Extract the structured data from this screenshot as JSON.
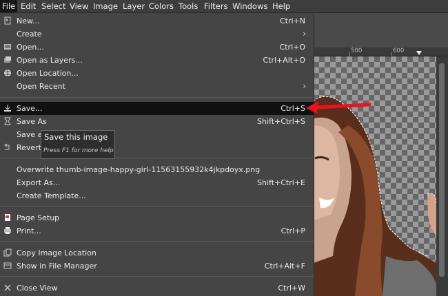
{
  "menubar": {
    "items": [
      "File",
      "Edit",
      "Select",
      "View",
      "Image",
      "Layer",
      "Colors",
      "Tools",
      "Filters",
      "Windows",
      "Help"
    ]
  },
  "ruler": {
    "ticks": [
      "500",
      "600"
    ]
  },
  "file_menu": {
    "new": {
      "label": "New...",
      "shortcut": "Ctrl+N",
      "icon": "new-image-icon"
    },
    "create": {
      "label": "Create",
      "submenu": "›"
    },
    "open": {
      "label": "Open...",
      "shortcut": "Ctrl+O",
      "icon": "open-image-icon"
    },
    "open_layers": {
      "label": "Open as Layers...",
      "shortcut": "Ctrl+Alt+O",
      "icon": "open-layers-icon"
    },
    "open_location": {
      "label": "Open Location...",
      "icon": "globe-icon"
    },
    "open_recent": {
      "label": "Open Recent",
      "submenu": "›"
    },
    "save": {
      "label": "Save...",
      "shortcut": "Ctrl+S",
      "icon": "save-icon"
    },
    "save_as": {
      "label": "Save As",
      "shortcut": "Shift+Ctrl+S",
      "icon": "save-as-icon"
    },
    "save_copy": {
      "label": "Save a"
    },
    "revert": {
      "label": "Revert",
      "icon": "revert-icon"
    },
    "overwrite": {
      "label": "Overwrite thumb-image-happy-girl-11563155932k4jkpdoyx.png"
    },
    "export_as": {
      "label": "Export As...",
      "shortcut": "Shift+Ctrl+E"
    },
    "create_template": {
      "label": "Create Template..."
    },
    "page_setup": {
      "label": "Page Setup",
      "icon": "page-setup-icon"
    },
    "print": {
      "label": "Print...",
      "shortcut": "Ctrl+P",
      "icon": "printer-icon"
    },
    "copy_location": {
      "label": "Copy Image Location",
      "icon": "copy-icon"
    },
    "show_file_manager": {
      "label": "Show in File Manager",
      "shortcut": "Ctrl+Alt+F",
      "icon": "file-manager-icon"
    },
    "close_view": {
      "label": "Close View",
      "shortcut": "Ctrl+W",
      "icon": "close-icon"
    }
  },
  "tooltip": {
    "title": "Save this image",
    "hint": "Press F1 for more help"
  },
  "colors": {
    "annotation_arrow": "#e8141c",
    "highlight": "#111111"
  }
}
